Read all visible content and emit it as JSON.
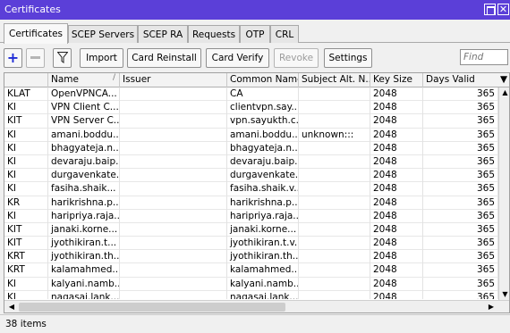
{
  "window": {
    "title": "Certificates"
  },
  "tabs": [
    {
      "label": "Certificates",
      "active": true
    },
    {
      "label": "SCEP Servers",
      "active": false
    },
    {
      "label": "SCEP RA",
      "active": false
    },
    {
      "label": "Requests",
      "active": false
    },
    {
      "label": "OTP",
      "active": false
    },
    {
      "label": "CRL",
      "active": false
    }
  ],
  "toolbar": {
    "import_label": "Import",
    "card_reinstall_label": "Card Reinstall",
    "card_verify_label": "Card Verify",
    "revoke_label": "Revoke",
    "settings_label": "Settings",
    "find_placeholder": "Find"
  },
  "table": {
    "columns": [
      "",
      "Name",
      "Issuer",
      "Common Name",
      "Subject Alt. N...",
      "Key Size",
      "Days Valid"
    ],
    "sort_indicator": "/",
    "rows": [
      [
        "KLAT",
        "OpenVPNCA...",
        "",
        "CA",
        "",
        "2048",
        "365"
      ],
      [
        "KI",
        "VPN Client C...",
        "",
        "clientvpn.say...",
        "",
        "2048",
        "365"
      ],
      [
        "KIT",
        "VPN Server C...",
        "",
        "vpn.sayukth.c...",
        "",
        "2048",
        "365"
      ],
      [
        "KI",
        "amani.boddu...",
        "",
        "amani.boddu...",
        "unknown:::",
        "2048",
        "365"
      ],
      [
        "KI",
        "bhagyateja.n...",
        "",
        "bhagyateja.n...",
        "",
        "2048",
        "365"
      ],
      [
        "KI",
        "devaraju.baip...",
        "",
        "devaraju.baip...",
        "",
        "2048",
        "365"
      ],
      [
        "KI",
        "durgavenkate...",
        "",
        "durgavenkate...",
        "",
        "2048",
        "365"
      ],
      [
        "KI",
        "fasiha.shaik...",
        "",
        "fasiha.shaik.v...",
        "",
        "2048",
        "365"
      ],
      [
        "KR",
        "harikrishna.p...",
        "",
        "harikrishna.p...",
        "",
        "2048",
        "365"
      ],
      [
        "KI",
        "haripriya.raja...",
        "",
        "haripriya.raja...",
        "",
        "2048",
        "365"
      ],
      [
        "KIT",
        "janaki.korne...",
        "",
        "janaki.korne...",
        "",
        "2048",
        "365"
      ],
      [
        "KIT",
        "jyothikiran.t...",
        "",
        "jyothikiran.t.v...",
        "",
        "2048",
        "365"
      ],
      [
        "KRT",
        "jyothikiran.th...",
        "",
        "jyothikiran.th...",
        "",
        "2048",
        "365"
      ],
      [
        "KRT",
        "kalamahmed...",
        "",
        "kalamahmed...",
        "",
        "2048",
        "365"
      ],
      [
        "KI",
        "kalyani.namb...",
        "",
        "kalyani.namb...",
        "",
        "2048",
        "365"
      ],
      [
        "KI",
        "nagasai.lank...",
        "",
        "nagasai.lank...",
        "",
        "2048",
        "365"
      ]
    ]
  },
  "status": {
    "item_count": "38 items"
  }
}
